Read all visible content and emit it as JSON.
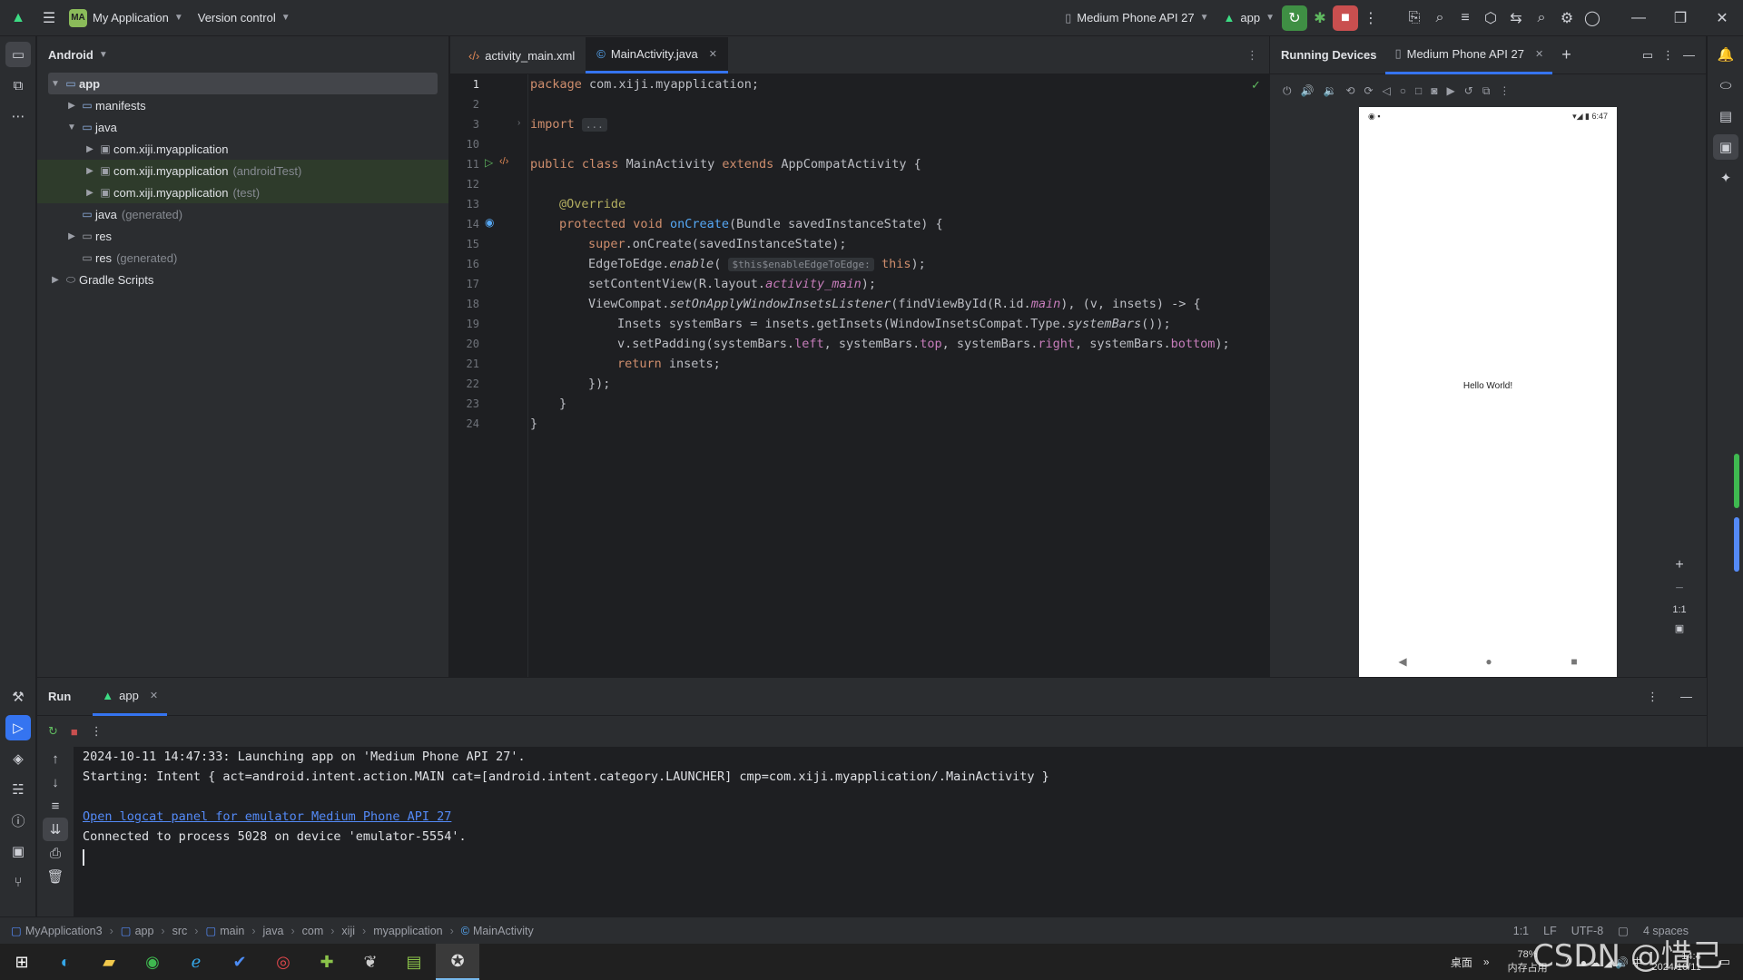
{
  "titlebar": {
    "project_badge": "MA",
    "project_name": "My Application",
    "version_control": "Version control",
    "device_selector": "Medium Phone API 27",
    "run_config": "app"
  },
  "project_pane": {
    "view": "Android",
    "tree": [
      {
        "label": "app",
        "suffix": "",
        "level": 0
      },
      {
        "label": "manifests",
        "suffix": "",
        "level": 1
      },
      {
        "label": "java",
        "suffix": "",
        "level": 1
      },
      {
        "label": "com.xiji.myapplication",
        "suffix": "",
        "level": 2
      },
      {
        "label": "com.xiji.myapplication",
        "suffix": "(androidTest)",
        "level": 2
      },
      {
        "label": "com.xiji.myapplication",
        "suffix": "(test)",
        "level": 2
      },
      {
        "label": "java",
        "suffix": "(generated)",
        "level": 1
      },
      {
        "label": "res",
        "suffix": "",
        "level": 1
      },
      {
        "label": "res",
        "suffix": "(generated)",
        "level": 1
      },
      {
        "label": "Gradle Scripts",
        "suffix": "",
        "level": 0
      }
    ]
  },
  "editor": {
    "tabs": [
      {
        "label": "activity_main.xml",
        "active": false
      },
      {
        "label": "MainActivity.java",
        "active": true
      }
    ],
    "line_numbers": [
      "1",
      "2",
      "3",
      "10",
      "11",
      "12",
      "13",
      "14",
      "15",
      "16",
      "17",
      "18",
      "19",
      "20",
      "21",
      "22",
      "23",
      "24"
    ],
    "lines": {
      "l1a": "package",
      "l1b": " com.xiji.myapplication;",
      "l3a": "import",
      "l3b": "...",
      "l11a": "public class",
      "l11b": " MainActivity ",
      "l11c": "extends",
      "l11d": " AppCompatActivity {",
      "l13": "@Override",
      "l14a": "protected void",
      "l14b": "onCreate",
      "l14c": "(Bundle savedInstanceState) {",
      "l15a": "super",
      "l15b": ".onCreate(savedInstanceState);",
      "l16a": "EdgeToEdge.",
      "l16b": "enable",
      "l16c": "(",
      "l16hint": "$this$enableEdgeToEdge:",
      "l16d": "this",
      "l16e": ");",
      "l17a": "setContentView(R.layout.",
      "l17b": "activity_main",
      "l17c": ");",
      "l18a": "ViewCompat.",
      "l18b": "setOnApplyWindowInsetsListener",
      "l18c": "(findViewById(R.id.",
      "l18d": "main",
      "l18e": "), (v, insets) -> {",
      "l19a": "Insets systemBars = insets.getInsets(WindowInsetsCompat.Type.",
      "l19b": "systemBars",
      "l19c": "());",
      "l20a": "v.setPadding(systemBars.",
      "l20b": "left",
      "l20c": ", systemBars.",
      "l20d": "top",
      "l20e": ", systemBars.",
      "l20f": "right",
      "l20g": ", systemBars.",
      "l20h": "bottom",
      "l20i": ");",
      "l21a": "return",
      "l21b": " insets;",
      "l22": "});",
      "l23": "}",
      "l24": "}"
    }
  },
  "devices": {
    "title": "Running Devices",
    "tab": "Medium Phone API 27",
    "phone_time": "6:47",
    "phone_text": "Hello World!",
    "zoom_label": "1:1"
  },
  "run": {
    "title": "Run",
    "tab": "app",
    "console": [
      "2024-10-11 14:47:33: Launching app on 'Medium Phone API 27'.",
      "Starting: Intent { act=android.intent.action.MAIN cat=[android.intent.category.LAUNCHER] cmp=com.xiji.myapplication/.MainActivity }",
      "Open logcat panel for emulator Medium Phone API 27",
      "Connected to process 5028 on device 'emulator-5554'."
    ]
  },
  "statusbar": {
    "breadcrumbs": [
      "MyApplication3",
      "app",
      "src",
      "main",
      "java",
      "com",
      "xiji",
      "myapplication",
      "MainActivity"
    ],
    "position": "1:1",
    "line_sep": "LF",
    "encoding": "UTF-8",
    "indent": "4 spaces"
  },
  "taskbar": {
    "desktop_label": "桌面",
    "mem_percent": "78%",
    "mem_label": "内存占用",
    "time": "14:4",
    "date": "2024/10/11",
    "watermark": "CSDN @惜己"
  },
  "colors": {
    "accent": "#3574f0",
    "background": "#1e1f22",
    "panel": "#2b2d30",
    "keyword": "#cf8e6d",
    "function": "#56a8f5",
    "field": "#c77dbb",
    "annotation": "#b3ae60",
    "link": "#548af7"
  }
}
